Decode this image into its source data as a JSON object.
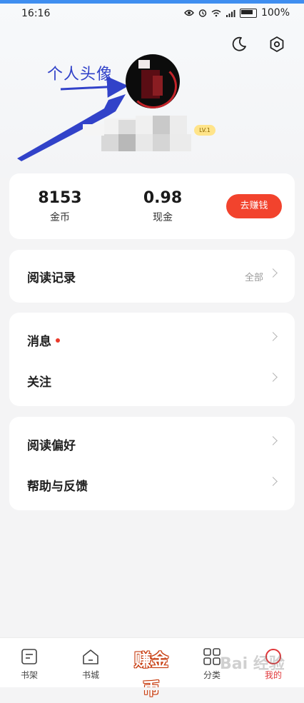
{
  "status_bar": {
    "time": "16:16",
    "battery_text": "100%"
  },
  "annotation": {
    "text": "个人头像"
  },
  "profile": {
    "level": "LV.1"
  },
  "wallet": {
    "gold_value": "8153",
    "gold_label": "金币",
    "cash_value": "0.98",
    "cash_label": "现金",
    "earn_button": "去赚钱"
  },
  "reading_history": {
    "title": "阅读记录",
    "more": "全部"
  },
  "section_messages": {
    "messages": "消息",
    "follow": "关注"
  },
  "section_settings": {
    "preference": "阅读偏好",
    "help": "帮助与反馈"
  },
  "tabbar": {
    "tabs": [
      {
        "label": "书架",
        "icon": "bookshelf-icon"
      },
      {
        "label": "书城",
        "icon": "home-icon"
      },
      {
        "label": "赚金币",
        "icon": "earn-coins-icon"
      },
      {
        "label": "分类",
        "icon": "category-grid-icon"
      },
      {
        "label": "我的",
        "icon": "profile-circle-icon"
      }
    ]
  },
  "colors": {
    "accent": "#f2432d",
    "annotation": "#3142c9",
    "level_badge": "#ffe48a"
  },
  "watermark": "Bai 经验"
}
